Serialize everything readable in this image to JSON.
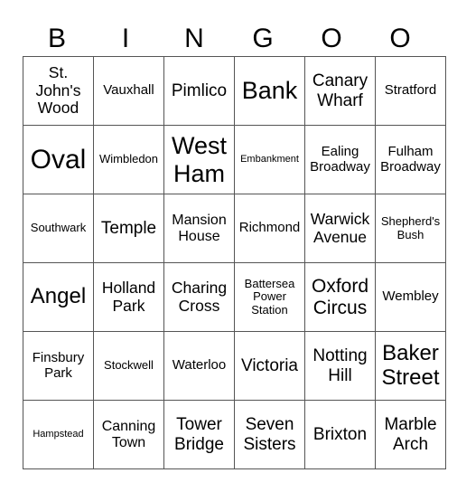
{
  "header": [
    "B",
    "I",
    "N",
    "G",
    "O",
    "O"
  ],
  "rows": [
    [
      "St. John's Wood",
      "Vauxhall",
      "Pimlico",
      "Bank",
      "Canary Wharf",
      "Stratford"
    ],
    [
      "Oval",
      "Wimbledon",
      "West Ham",
      "Embankment",
      "Ealing Broadway",
      "Fulham Broadway"
    ],
    [
      "Southwark",
      "Temple",
      "Mansion House",
      "Richmond",
      "Warwick Avenue",
      "Shepherd's Bush"
    ],
    [
      "Angel",
      "Holland Park",
      "Charing Cross",
      "Battersea Power Station",
      "Oxford Circus",
      "Wembley"
    ],
    [
      "Finsbury Park",
      "Stockwell",
      "Waterloo",
      "Victoria",
      "Notting Hill",
      "Baker Street"
    ],
    [
      "Hampstead",
      "Canning Town",
      "Tower Bridge",
      "Seven Sisters",
      "Brixton",
      "Marble Arch"
    ]
  ]
}
